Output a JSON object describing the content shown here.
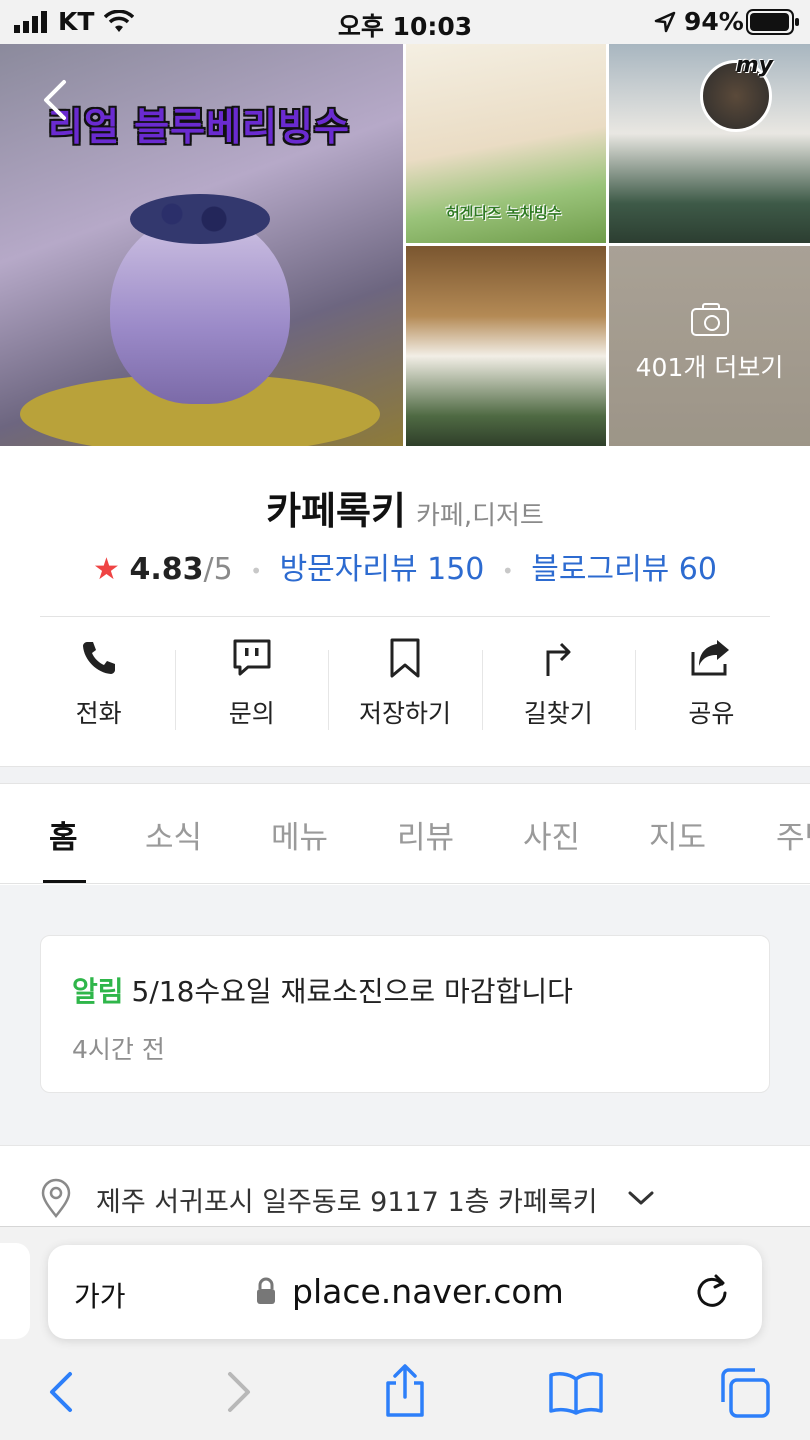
{
  "status_bar": {
    "carrier": "KT",
    "time": "오후 10:03",
    "battery_percent": "94%"
  },
  "photos": {
    "main_overlay_text": "리얼 블루베리빙수",
    "photo1_label": "허겐다즈 녹차빙수",
    "my_badge": "my",
    "more_label": "401개 더보기",
    "icons": {
      "back": "chevron-left-icon",
      "camera": "camera-icon"
    }
  },
  "place": {
    "name": "카페록키",
    "category": "카페,디저트",
    "star": "★",
    "rating": "4.83",
    "rating_max": "/5",
    "visitor_reviews": "방문자리뷰 150",
    "blog_reviews": "블로그리뷰 60"
  },
  "actions": [
    {
      "label": "전화",
      "icon": "phone-icon"
    },
    {
      "label": "문의",
      "icon": "chat-icon"
    },
    {
      "label": "저장하기",
      "icon": "bookmark-icon"
    },
    {
      "label": "길찾기",
      "icon": "directions-icon"
    },
    {
      "label": "공유",
      "icon": "share-icon"
    }
  ],
  "tabs": [
    "홈",
    "소식",
    "메뉴",
    "리뷰",
    "사진",
    "지도",
    "주변"
  ],
  "active_tab": "홈",
  "notice": {
    "tag": "알림",
    "message": "5/18수요일 재료소진으로 마감합니다",
    "time_ago": "4시간 전"
  },
  "address": {
    "text": "제주 서귀포시 일주동로 9117 1층 카페록키"
  },
  "browser": {
    "text_size_label": "가가",
    "url": "place.naver.com"
  },
  "colors": {
    "link_blue": "#2d6bd0",
    "notice_green": "#2fb64a",
    "star_red": "#ef4444",
    "safari_blue": "#2d7ff9"
  }
}
